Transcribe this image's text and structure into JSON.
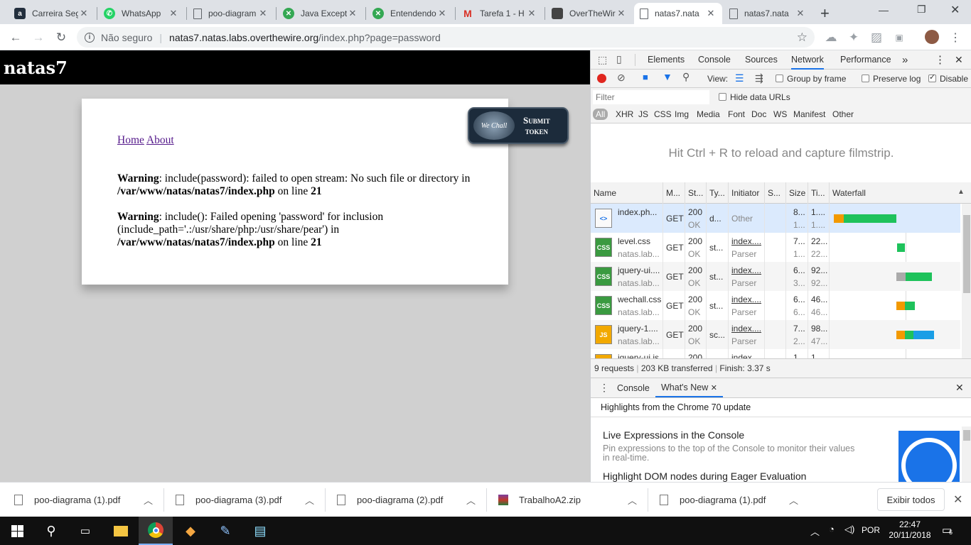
{
  "tabs": [
    {
      "title": "Carreira Seg",
      "favicon": "a",
      "color": "#232f3e"
    },
    {
      "title": "WhatsApp",
      "favicon": "whatsapp-icon",
      "color": "#25d366"
    },
    {
      "title": "poo-diagram",
      "favicon": "page-icon",
      "color": "#5f6368"
    },
    {
      "title": "Java Excepti",
      "favicon": "green-icon",
      "color": "#34a853"
    },
    {
      "title": "Entendendo",
      "favicon": "green-icon",
      "color": "#34a853"
    },
    {
      "title": "Tarefa 1 - H",
      "favicon": "M",
      "color": "#d93025"
    },
    {
      "title": "OverTheWir",
      "favicon": "otw-icon",
      "color": "#444"
    },
    {
      "title": "natas7.nata",
      "favicon": "page-icon",
      "color": "#5f6368"
    },
    {
      "title": "natas7.nata",
      "favicon": "page-icon",
      "color": "#5f6368"
    }
  ],
  "address": {
    "security": "Não seguro",
    "host": "natas7.natas.labs.overthewire.org",
    "path": "/index.php?page=password"
  },
  "page": {
    "header": "natas7",
    "nav": {
      "home": "Home",
      "about": "About"
    },
    "warning1": {
      "label": "Warning",
      "text1": ": include(password): failed to open stream: No such file or directory in ",
      "path": "/var/www/natas/natas7/index.php",
      "text2": " on line ",
      "line": "21"
    },
    "warning2": {
      "label": "Warning",
      "text1": ": include(): Failed opening 'password' for inclusion (include_path='.:/usr/share/php:/usr/share/pear') in ",
      "path": "/var/www/natas/natas7/index.php",
      "text2": " on line ",
      "line": "21"
    },
    "wechall": {
      "logo": "We Chall",
      "line1": "Submit",
      "line2": "token"
    }
  },
  "devtools": {
    "tabs": [
      "Elements",
      "Console",
      "Sources",
      "Network",
      "Performance"
    ],
    "active_tab": "Network",
    "view_label": "View:",
    "group_by_frame": "Group by frame",
    "preserve_log": "Preserve log",
    "disable": "Disable",
    "filter_placeholder": "Filter",
    "hide_data_urls": "Hide data URLs",
    "types": [
      "All",
      "XHR",
      "JS",
      "CSS",
      "Img",
      "Media",
      "Font",
      "Doc",
      "WS",
      "Manifest",
      "Other"
    ],
    "filmstrip_hint": "Hit Ctrl + R to reload and capture filmstrip.",
    "columns": [
      "Name",
      "M...",
      "St...",
      "Ty...",
      "Initiator",
      "S...",
      "Size",
      "Ti...",
      "Waterfall"
    ],
    "rows": [
      {
        "name": "index.ph...",
        "sub": "",
        "icon": "<>",
        "method": "GET",
        "status": "200",
        "status_text": "OK",
        "type": "d...",
        "initiator": "Other",
        "initiator_sub": "",
        "size": "8...",
        "size2": "1...",
        "time": "1....",
        "time2": "1...."
      },
      {
        "name": "level.css",
        "sub": "natas.lab...",
        "icon": "CSS",
        "method": "GET",
        "status": "200",
        "status_text": "OK",
        "type": "st...",
        "initiator": "index....",
        "initiator_sub": "Parser",
        "size": "7...",
        "size2": "1...",
        "time": "22...",
        "time2": "22..."
      },
      {
        "name": "jquery-ui....",
        "sub": "natas.lab...",
        "icon": "CSS",
        "method": "GET",
        "status": "200",
        "status_text": "OK",
        "type": "st...",
        "initiator": "index....",
        "initiator_sub": "Parser",
        "size": "6...",
        "size2": "3...",
        "time": "92...",
        "time2": "92..."
      },
      {
        "name": "wechall.css",
        "sub": "natas.lab...",
        "icon": "CSS",
        "method": "GET",
        "status": "200",
        "status_text": "OK",
        "type": "st...",
        "initiator": "index....",
        "initiator_sub": "Parser",
        "size": "6...",
        "size2": "6...",
        "time": "46...",
        "time2": "46..."
      },
      {
        "name": "jquery-1....",
        "sub": "natas.lab...",
        "icon": "JS",
        "method": "GET",
        "status": "200",
        "status_text": "OK",
        "type": "sc...",
        "initiator": "index....",
        "initiator_sub": "Parser",
        "size": "7...",
        "size2": "2...",
        "time": "98...",
        "time2": "47..."
      },
      {
        "name": "jquery-ui.js",
        "sub": "",
        "icon": "JS",
        "method": "",
        "status": "200",
        "status_text": "",
        "type": "",
        "initiator": "index",
        "initiator_sub": "",
        "size": "1",
        "size2": "",
        "time": "1",
        "time2": ""
      }
    ],
    "summary": {
      "requests": "9 requests",
      "transferred": "203 KB transferred",
      "finish": "Finish: 3.37 s"
    },
    "drawer": {
      "tabs": [
        "Console",
        "What's New"
      ],
      "highlight": "Highlights from the Chrome 70 update",
      "item1_title": "Live Expressions in the Console",
      "item1_desc": "Pin expressions to the top of the Console to monitor their values in real-time.",
      "item2_title": "Highlight DOM nodes during Eager Evaluation"
    }
  },
  "downloads": {
    "items": [
      "poo-diagrama (1).pdf",
      "poo-diagrama (3).pdf",
      "poo-diagrama (2).pdf",
      "TrabalhoA2.zip",
      "poo-diagrama (1).pdf"
    ],
    "show_all": "Exibir todos"
  },
  "taskbar": {
    "lang": "POR",
    "time": "22:47",
    "date": "20/11/2018",
    "notifications": "6"
  }
}
